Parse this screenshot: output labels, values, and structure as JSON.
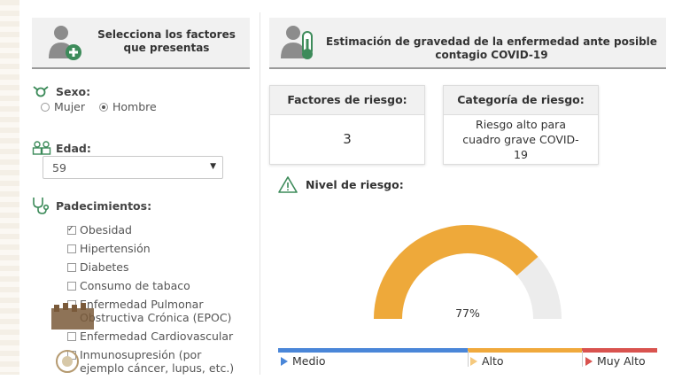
{
  "left_panel": {
    "header_title": "Selecciona los factores que presentas",
    "sexo": {
      "label": "Sexo:",
      "options": [
        {
          "label": "Mujer",
          "selected": false
        },
        {
          "label": "Hombre",
          "selected": true
        }
      ]
    },
    "edad": {
      "label": "Edad:",
      "value": "59"
    },
    "padecimientos": {
      "label": "Padecimientos:",
      "items": [
        {
          "label": "Obesidad",
          "checked": true
        },
        {
          "label": "Hipertensión",
          "checked": false
        },
        {
          "label": "Diabetes",
          "checked": false
        },
        {
          "label": "Consumo de tabaco",
          "checked": false
        },
        {
          "label": "Enfermedad Pulmonar Obstructiva Crónica (EPOC)",
          "checked": false
        },
        {
          "label": "Enfermedad Cardiovascular",
          "checked": false
        },
        {
          "label": "Inmunosupresión (por ejemplo cáncer, lupus, etc.)",
          "checked": false
        }
      ]
    }
  },
  "right_panel": {
    "header_title": "Estimación de gravedad de la enfermedad ante posible contagio COVID-19",
    "factores": {
      "title": "Factores de riesgo:",
      "value": "3"
    },
    "categoria": {
      "title": "Categoría de riesgo:",
      "value": "Riesgo alto para cuadro grave COVID-19"
    },
    "nivel": {
      "label": "Nivel de riesgo:",
      "percent": 77,
      "percent_label": "77%"
    },
    "scale": [
      {
        "label": "Medio",
        "color": "#4a86d8"
      },
      {
        "label": "Alto",
        "color": "#f0a93c"
      },
      {
        "label": "Muy Alto",
        "color": "#d9534f"
      }
    ]
  },
  "colors": {
    "accent_green": "#3d8b5a",
    "icon_gray": "#8c8c8c",
    "gauge_fill": "#eea93a",
    "gauge_track": "#ececec",
    "header_bg": "#f1f1f1"
  }
}
